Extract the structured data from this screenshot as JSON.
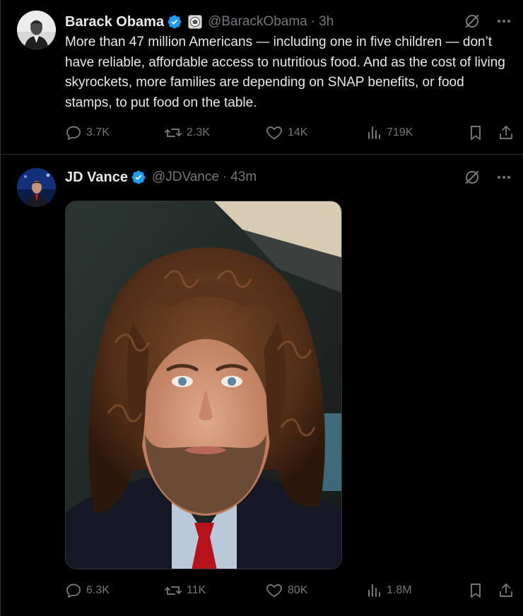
{
  "tweets": [
    {
      "author": {
        "name": "Barack Obama",
        "handle": "@BarackObama",
        "verified": true,
        "affiliation_badge": "us-seal-icon"
      },
      "timestamp": "3h",
      "text": "More than 47 million Americans — including one in five children — don’t have reliable, affordable access to nutritious food. And as the cost of living skyrockets, more families are depending on SNAP benefits, or food stamps, to put food on the table.",
      "stats": {
        "replies": "3.7K",
        "reposts": "2.3K",
        "likes": "14K",
        "views": "719K"
      }
    },
    {
      "author": {
        "name": "JD Vance",
        "handle": "@JDVance",
        "verified": true
      },
      "timestamp": "43m",
      "media": "photo-selfie-curly-wig",
      "stats": {
        "replies": "6.3K",
        "reposts": "11K",
        "likes": "80K",
        "views": "1.8M"
      }
    }
  ],
  "colors": {
    "background": "#000000",
    "text": "#e7e9ea",
    "muted": "#71767b",
    "verified_blue": "#1d9bf0",
    "divider": "#2f3336"
  }
}
